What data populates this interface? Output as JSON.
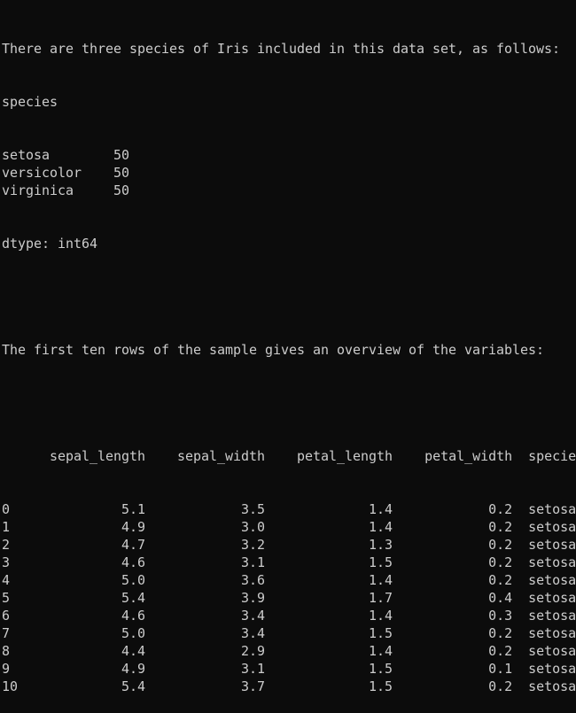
{
  "console": {
    "intro": "There are three species of Iris included in this data set, as follows:",
    "counts_header": "species",
    "counts": [
      {
        "name": "setosa",
        "count": "50"
      },
      {
        "name": "versicolor",
        "count": "50"
      },
      {
        "name": "virginica",
        "count": "50"
      }
    ],
    "dtype": "dtype: int64",
    "table_intro": "The first ten rows of the sample gives an overview of the variables:",
    "table": {
      "columns": [
        "sepal_length",
        "sepal_width",
        "petal_length",
        "petal_width",
        "species"
      ],
      "rows": [
        {
          "index": "0",
          "values": [
            "5.1",
            "3.5",
            "1.4",
            "0.2",
            "setosa"
          ]
        },
        {
          "index": "1",
          "values": [
            "4.9",
            "3.0",
            "1.4",
            "0.2",
            "setosa"
          ]
        },
        {
          "index": "2",
          "values": [
            "4.7",
            "3.2",
            "1.3",
            "0.2",
            "setosa"
          ]
        },
        {
          "index": "3",
          "values": [
            "4.6",
            "3.1",
            "1.5",
            "0.2",
            "setosa"
          ]
        },
        {
          "index": "4",
          "values": [
            "5.0",
            "3.6",
            "1.4",
            "0.2",
            "setosa"
          ]
        },
        {
          "index": "5",
          "values": [
            "5.4",
            "3.9",
            "1.7",
            "0.4",
            "setosa"
          ]
        },
        {
          "index": "6",
          "values": [
            "4.6",
            "3.4",
            "1.4",
            "0.3",
            "setosa"
          ]
        },
        {
          "index": "7",
          "values": [
            "5.0",
            "3.4",
            "1.5",
            "0.2",
            "setosa"
          ]
        },
        {
          "index": "8",
          "values": [
            "4.4",
            "2.9",
            "1.4",
            "0.2",
            "setosa"
          ]
        },
        {
          "index": "9",
          "values": [
            "4.9",
            "3.1",
            "1.5",
            "0.1",
            "setosa"
          ]
        },
        {
          "index": "10",
          "values": [
            "5.4",
            "3.7",
            "1.5",
            "0.2",
            "setosa"
          ]
        }
      ]
    },
    "colors": {
      "background": "#0c0c0c",
      "text": "#cccccc"
    }
  }
}
